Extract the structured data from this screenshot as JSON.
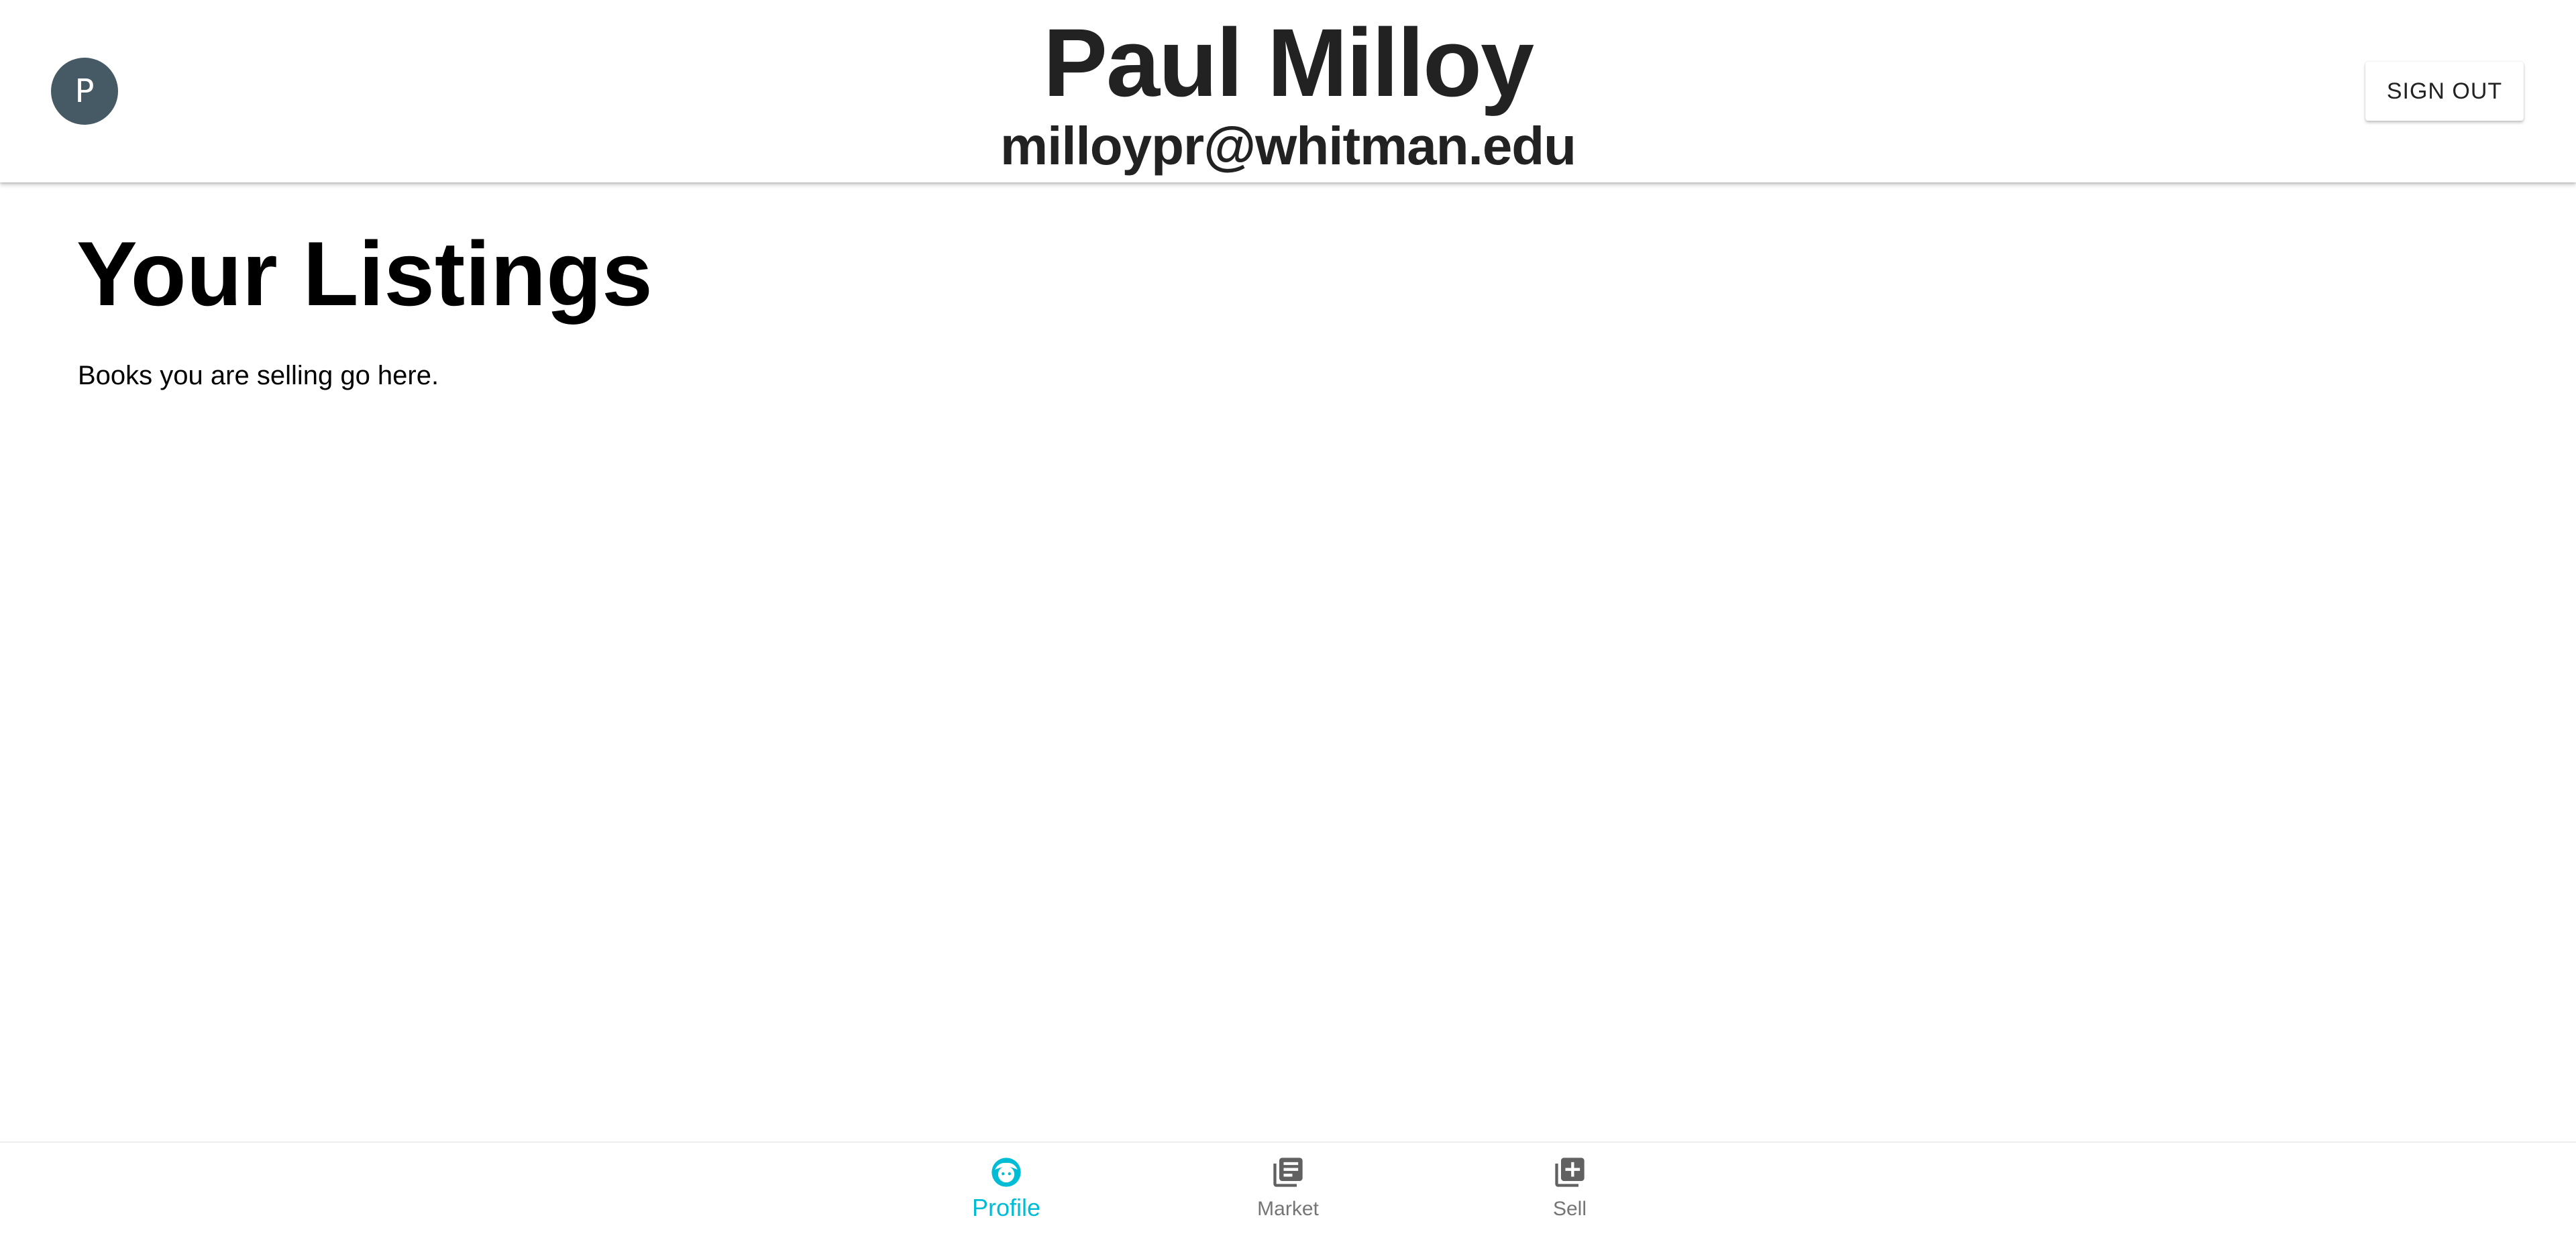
{
  "header": {
    "avatar_letter": "P",
    "user_name": "Paul Milloy",
    "user_email": "milloypr@whitman.edu",
    "sign_out_label": "SIGN OUT"
  },
  "main": {
    "section_title": "Your Listings",
    "section_description": "Books you are selling go here."
  },
  "bottom_nav": {
    "items": [
      {
        "label": "Profile",
        "icon": "face-icon",
        "active": true
      },
      {
        "label": "Market",
        "icon": "library-books-icon",
        "active": false
      },
      {
        "label": "Sell",
        "icon": "add-library-icon",
        "active": false
      }
    ]
  },
  "colors": {
    "avatar_bg": "#455a64",
    "active_nav": "#00bcd4",
    "inactive_nav": "#757575",
    "text_dark": "#222222"
  }
}
